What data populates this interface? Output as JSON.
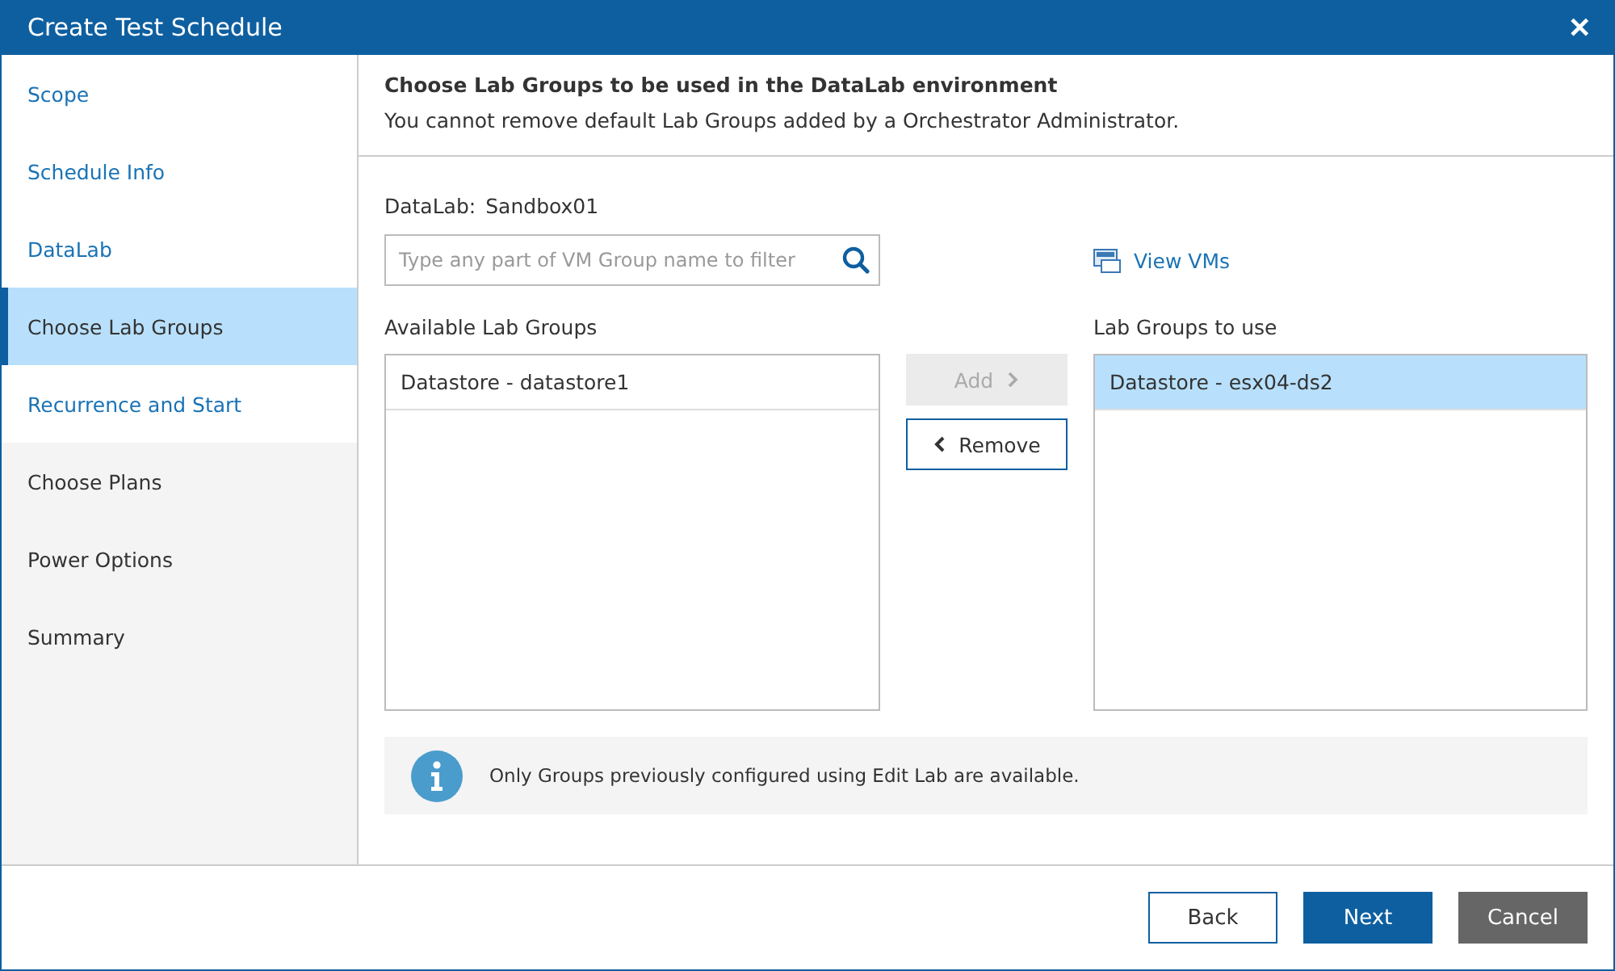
{
  "window": {
    "title": "Create Test Schedule",
    "close": "✕"
  },
  "sidebar": {
    "items": [
      {
        "label": "Scope",
        "selected": false,
        "visited": true
      },
      {
        "label": "Schedule Info",
        "selected": false,
        "visited": true
      },
      {
        "label": "DataLab",
        "selected": false,
        "visited": true
      },
      {
        "label": "Choose Lab Groups",
        "selected": true,
        "visited": true
      },
      {
        "label": "Recurrence and Start",
        "selected": false,
        "visited": true
      },
      {
        "label": "Choose Plans",
        "selected": false,
        "visited": false
      },
      {
        "label": "Power Options",
        "selected": false,
        "visited": false
      },
      {
        "label": "Summary",
        "selected": false,
        "visited": false
      }
    ]
  },
  "header": {
    "title": "Choose Lab Groups to be used in the DataLab environment",
    "subtitle": "You cannot remove default Lab Groups added by a Orchestrator Administrator."
  },
  "datalab": {
    "label": "DataLab:",
    "value": "Sandbox01"
  },
  "filter": {
    "placeholder": "Type any part of VM Group name to filter"
  },
  "view_vms": "View VMs",
  "available": {
    "label": "Available Lab Groups",
    "items": [
      {
        "label": "Datastore - datastore1",
        "selected": false
      }
    ]
  },
  "transfer": {
    "add": {
      "label": "Add",
      "disabled": true
    },
    "remove": {
      "label": "Remove",
      "disabled": false
    }
  },
  "to_use": {
    "label": "Lab Groups to use",
    "items": [
      {
        "label": "Datastore - esx04-ds2",
        "selected": true
      }
    ]
  },
  "info": "Only Groups previously configured using Edit Lab are available.",
  "buttons": [
    {
      "label": "Back",
      "kind": "secondary"
    },
    {
      "label": "Next",
      "kind": "primary"
    },
    {
      "label": "Cancel",
      "kind": "cancel"
    }
  ]
}
